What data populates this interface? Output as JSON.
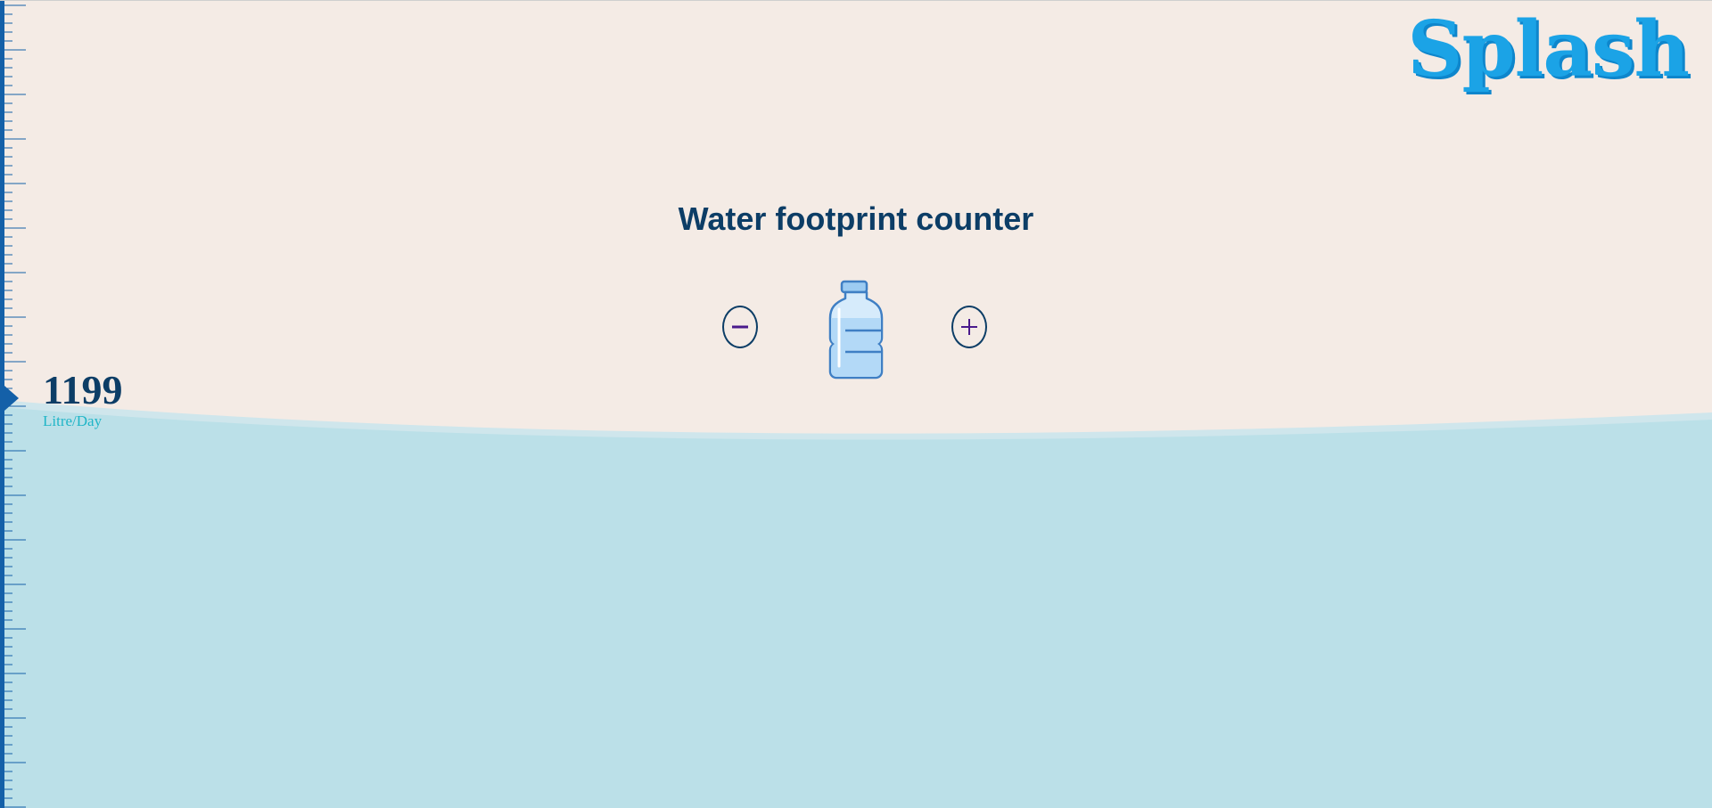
{
  "brand": {
    "logo_text": "Splash"
  },
  "page": {
    "title": "Water footprint counter"
  },
  "counter": {
    "decrement_label": "−",
    "increment_label": "+",
    "item_icon": "water-bottle-icon"
  },
  "readout": {
    "value": "1199",
    "unit": "Litre/Day"
  },
  "colors": {
    "background": "#f4ebe5",
    "water": "#bbe0e8",
    "ruler": "#1460a8",
    "title": "#0c3d66",
    "logo": "#1ba3e6",
    "unit_text": "#1fb5c7",
    "button_symbol": "#4a1a8c"
  }
}
